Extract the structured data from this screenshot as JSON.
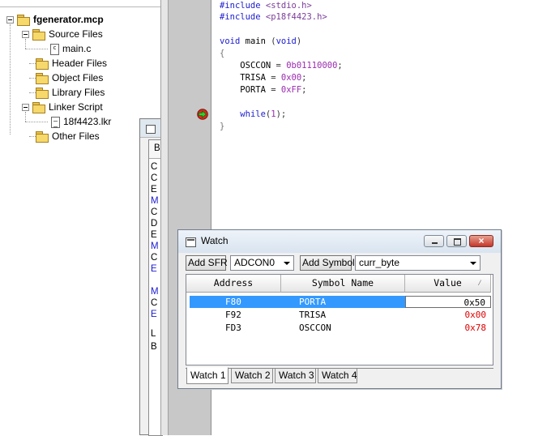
{
  "project": {
    "name": "fgenerator.mcp",
    "folders": [
      {
        "label": "Source Files",
        "files": [
          "main.c"
        ]
      },
      {
        "label": "Header Files",
        "files": []
      },
      {
        "label": "Object Files",
        "files": []
      },
      {
        "label": "Library Files",
        "files": []
      },
      {
        "label": "Linker Script",
        "files": [
          "18f4423.lkr"
        ]
      },
      {
        "label": "Other Files",
        "files": []
      }
    ],
    "icons": {
      "folder": "folder-icon",
      "c_file": "c-file-icon",
      "lkr_file": "linker-file-icon",
      "collapse": "minus-expander-icon"
    }
  },
  "editor": {
    "lines": {
      "l1_directive": "#include",
      "l1_header": "<stdio.h>",
      "l2_directive": "#include",
      "l2_header": "<p18f4423.h>",
      "l4_type": "void",
      "l4_name": "main",
      "l4_open": "(",
      "l4_param": "void",
      "l4_close": ")",
      "l5": "{",
      "l6_reg": "OSCCON",
      "l6_op": " = ",
      "l6_val": "0b01110000",
      "l6_end": ";",
      "l7_reg": "TRISA",
      "l7_op": " = ",
      "l7_val": "0x00",
      "l7_end": ";",
      "l8_reg": "PORTA",
      "l8_op": " = ",
      "l8_val": "0xFF",
      "l8_end": ";",
      "l10_kw": "while",
      "l10_open": "(",
      "l10_val": "1",
      "l10_close": ");",
      "l11": "}"
    },
    "colors": {
      "keyword": "#1b1bd0",
      "number": "#9b2bb0"
    },
    "marker_icon": "program-counter-arrow-icon"
  },
  "background_window": {
    "visible_chars": [
      "B",
      "C",
      "C",
      "E",
      "M",
      "C",
      "D",
      "E",
      "M",
      "C",
      "E",
      "M",
      "C",
      "E",
      "L",
      "B"
    ]
  },
  "watch": {
    "title": "Watch",
    "add_sfr_label": "Add SFR",
    "sfr_selected": "ADCON0",
    "add_symbol_label": "Add Symbol",
    "symbol_selected": "curr_byte",
    "columns": [
      "Address",
      "Symbol Name",
      "Value"
    ],
    "rows": [
      {
        "address": "F80",
        "symbol": "PORTA",
        "value": "0x50",
        "selected": true,
        "changed": false
      },
      {
        "address": "F92",
        "symbol": "TRISA",
        "value": "0x00",
        "selected": false,
        "changed": true
      },
      {
        "address": "FD3",
        "symbol": "OSCCON",
        "value": "0x78",
        "selected": false,
        "changed": true
      }
    ],
    "tabs": [
      "Watch 1",
      "Watch 2",
      "Watch 3",
      "Watch 4"
    ],
    "active_tab": "Watch 1",
    "close_glyph": "×",
    "colors": {
      "changed_value": "#e00000",
      "selection": "#3399ff"
    }
  }
}
